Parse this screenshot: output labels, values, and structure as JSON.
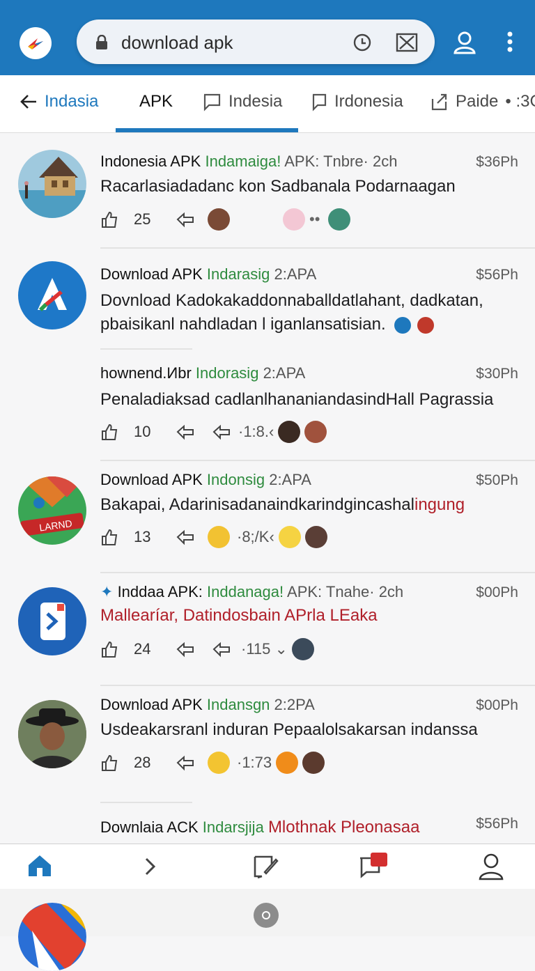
{
  "search": {
    "query": "download apk"
  },
  "tabs": [
    {
      "label": "Indasia"
    },
    {
      "label": "APK"
    },
    {
      "label": "Indesia"
    },
    {
      "label": "Irdonesia"
    },
    {
      "label": "Paide"
    },
    {
      "label": "• :3C"
    }
  ],
  "posts": [
    {
      "author": "Indonesia APK",
      "tag": "Indamaiga!",
      "meta": "APK: Tnbre· 2ch",
      "time": "$36Ph",
      "text": [
        "Racarlasiadadanc kon Sadbanala Podarnaagan"
      ],
      "likes": "25",
      "extra": "",
      "text_red_tail": ""
    },
    {
      "author": "Download APK",
      "tag": "Indarasig",
      "meta": "2:APA",
      "time": "$56Ph",
      "text": [
        "Dovnload Kadokakaddonnaballdatlahant, dadkatan,",
        "pbaisikanl nahdladan l iganlansatisian."
      ],
      "likes": "",
      "extra": "",
      "text_red_tail": ""
    },
    {
      "author": "hownend.Иbr",
      "tag": "Indorasig",
      "meta": "2:APA",
      "time": "$30Ph",
      "text": [
        "Penaladiaksad cadlanlhananiandasindHall Pagrassia"
      ],
      "likes": "10",
      "extra": "·1:8.‹",
      "text_red_tail": ""
    },
    {
      "author": "Download APK",
      "tag": "Indonsig",
      "meta": "2:APA",
      "time": "$50Ph",
      "text": [
        "Bakapai, Adarinisadanaindkarindgincashal"
      ],
      "likes": "13",
      "extra": "·8;/K‹",
      "text_red_tail": "ingung"
    },
    {
      "author": "Inddaa APK:",
      "tag": "Inddanaga!",
      "meta": "APK: Tnahe· 2ch",
      "time": "$00Ph",
      "text": [
        "Mallearíar, Datindosbain APrla LEaka"
      ],
      "likes": "24",
      "extra": "·115 ⌄",
      "text_red_tail": ""
    },
    {
      "author": "Download APK",
      "tag": "Indansgn",
      "meta": "2:2PA",
      "time": "$00Ph",
      "text": [
        "Usdeakarsranl induran Pepaalolsakarsan indanssa"
      ],
      "likes": "28",
      "extra": "·1:73",
      "text_red_tail": ""
    },
    {
      "author": "Downlaia ACK",
      "tag": "Indarsjija",
      "meta": "",
      "time": "$56Ph",
      "text": [
        "Mlothnak Pleonasaa"
      ],
      "likes": "",
      "extra": "",
      "text_red_tail": ""
    }
  ],
  "avatar_badge": "LARND",
  "colors": {
    "brand": "#1e78bd",
    "tag_green": "#2e8b3e",
    "accent_red": "#b0202a"
  }
}
